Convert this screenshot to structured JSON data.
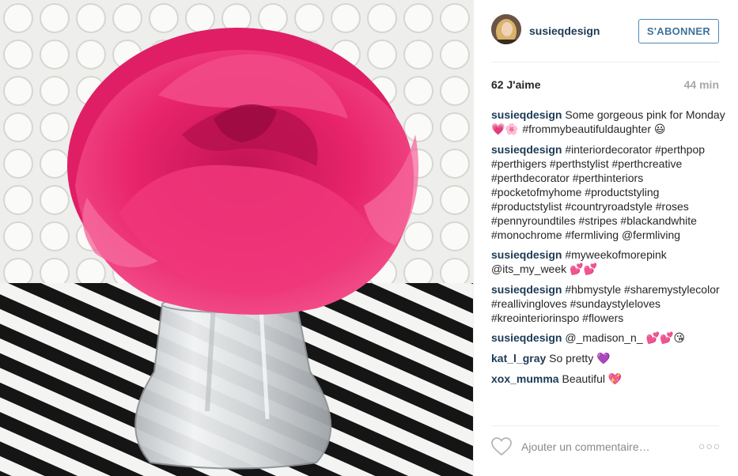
{
  "post": {
    "username": "susieqdesign",
    "follow_label": "S'ABONNER",
    "likes": "62 J'aime",
    "time": "44 min"
  },
  "comments": [
    {
      "author": "susieqdesign",
      "text": "Some gorgeous pink for Monday ",
      "emoji": "💗🌸 ",
      "tags": "#frommybeautifuldaughter ",
      "emoji2": "😃"
    },
    {
      "author": "susieqdesign",
      "text": "#interiordecorator #perthpop #perthigers #perthstylist #perthcreative #perthdecorator #perthinteriors #pocketofmyhome #productstyling #productstylist #countryroadstyle #roses #pennyroundtiles #stripes #blackandwhite #monochrome #fermliving @fermliving"
    },
    {
      "author": "susieqdesign",
      "text": "#myweekofmorepink @its_my_week ",
      "emoji": "💕💕"
    },
    {
      "author": "susieqdesign",
      "text": "#hbmystyle #sharemystylecolor #reallivingloves #sundaystyleloves #kreointeriorinspo #flowers"
    },
    {
      "author": "susieqdesign",
      "text": "@_madison_n_ ",
      "emoji": "💕💕😘"
    },
    {
      "author": "kat_l_gray",
      "text": "So pretty ",
      "emoji": "💜"
    },
    {
      "author": "xox_mumma",
      "text": "Beautiful ",
      "emoji": "💖"
    }
  ],
  "actions": {
    "comment_placeholder": "Ajouter un commentaire…",
    "more_label": "○○○"
  },
  "colors": {
    "username": "#1c3a55",
    "follow_border": "#4f86b8",
    "muted": "#a5a7aa",
    "rose": "#e8246a"
  }
}
